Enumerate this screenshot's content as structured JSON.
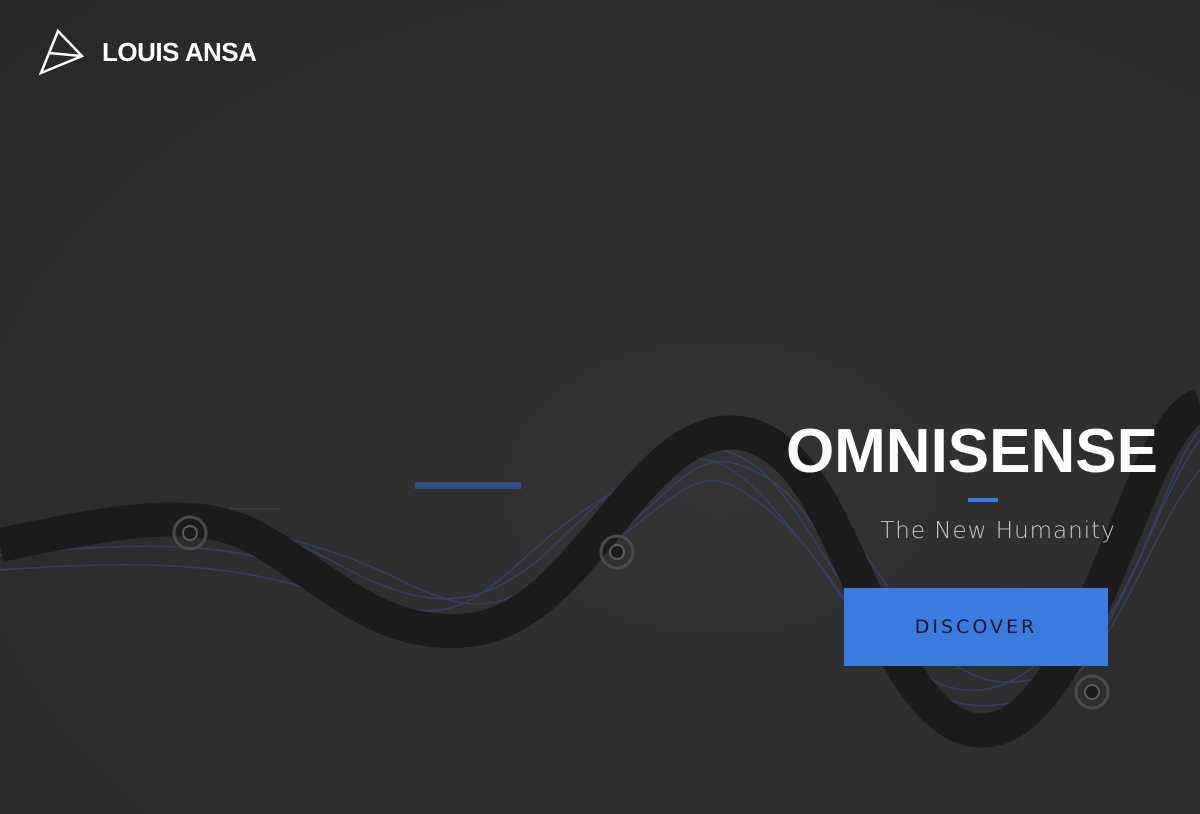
{
  "brand": {
    "logo_icon": "triangle-logo-icon",
    "name": "LOUIS ANSA"
  },
  "hero": {
    "title": "OMNISENSE",
    "subtitle": "The New Humanity",
    "button_label": "DISCOVER"
  },
  "colors": {
    "background": "#2d2d2e",
    "accent": "#3b7be0",
    "wave_dark": "#1b1b1c",
    "wave_line": "#3a4a7a"
  }
}
